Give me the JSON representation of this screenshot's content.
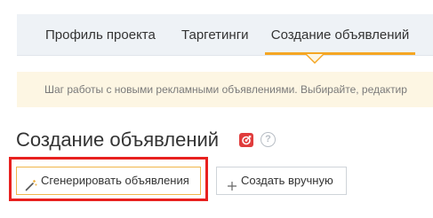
{
  "tabs": [
    {
      "label": "Профиль проекта",
      "active": false
    },
    {
      "label": "Таргетинги",
      "active": false
    },
    {
      "label": "Создание объявлений",
      "active": true
    }
  ],
  "banner": {
    "text": "Шаг работы с новыми рекламными объявлениями. Выбирайте, редактир"
  },
  "section": {
    "title": "Создание объявлений",
    "help_glyph": "?"
  },
  "actions": {
    "generate_label": "Сгенерировать объявления",
    "manual_label": "Создать вручную"
  },
  "icons": {
    "badge": "red-badge-icon",
    "help": "question-icon",
    "generate": "magic-wand-icon",
    "manual": "plus-icon"
  },
  "colors": {
    "accent": "#f5a623",
    "highlight": "#e8211f",
    "tabbar_bg": "#eef2f6",
    "banner_bg": "#fdf6e3",
    "badge": "#e03c3c"
  }
}
